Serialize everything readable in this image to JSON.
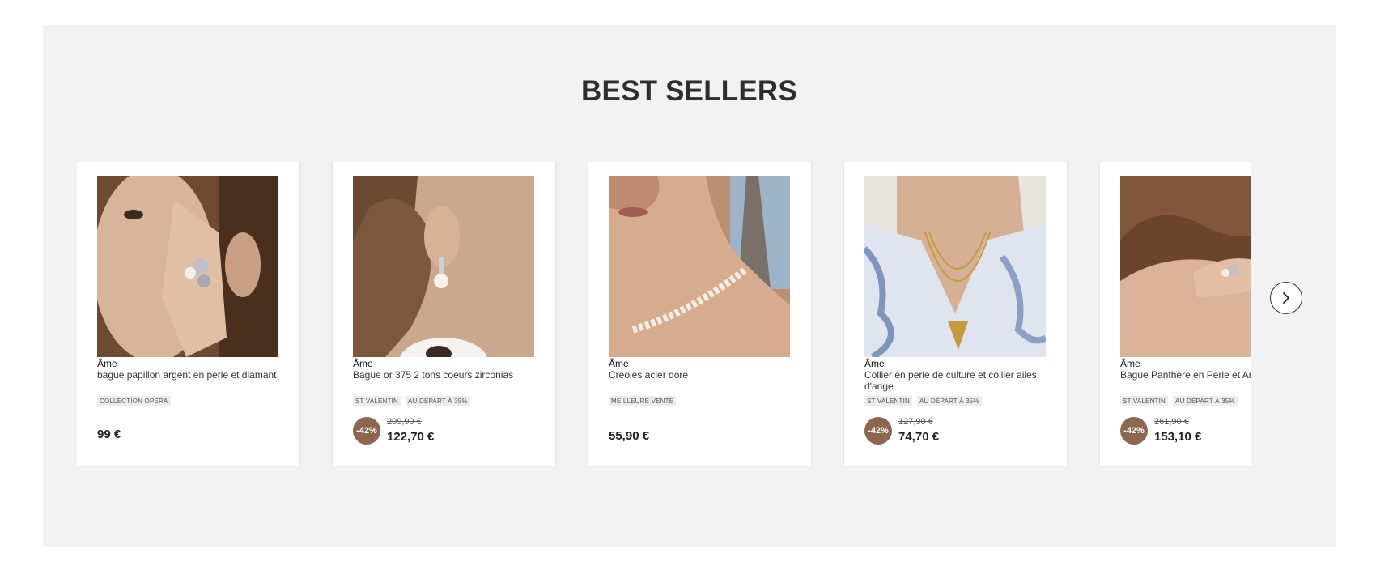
{
  "section": {
    "title": "BEST SELLERS"
  },
  "products": [
    {
      "brand": "Âme",
      "name": "bague papillon argent en perle et diamant",
      "tags": [
        "COLLECTION OPÉRA"
      ],
      "price": "99 €",
      "image": "woman-hand-ring-photo"
    },
    {
      "brand": "Âme",
      "name": "Bague or 375 2 tons coeurs zirconias",
      "tags": [
        "ST VALENTIN",
        "AU DÉPART À 35%"
      ],
      "discount": "-42%",
      "old_price": "209,90 €",
      "price": "122,70 €",
      "image": "pearl-earring-photo"
    },
    {
      "brand": "Âme",
      "name": "Créoles acier doré",
      "tags": [
        "MEILLEURE VENTE"
      ],
      "price": "55,90 €",
      "image": "pearl-necklace-photo"
    },
    {
      "brand": "Âme",
      "name": "Collier en perle de culture et collier ailes d'ange",
      "tags": [
        "ST VALENTIN",
        "AU DÉPART À 35%"
      ],
      "discount": "-42%",
      "old_price": "127,90 €",
      "price": "74,70 €",
      "image": "gold-necklace-photo"
    },
    {
      "brand": "Âme",
      "name": "Bague Panthère en Perle et Argent",
      "tags": [
        "ST VALENTIN",
        "AU DÉPART À 35%"
      ],
      "discount": "-42%",
      "old_price": "261,90 €",
      "price": "153,10 €",
      "image": "hand-ring-photo"
    }
  ],
  "carousel": {
    "next_icon": "chevron-right-icon"
  }
}
